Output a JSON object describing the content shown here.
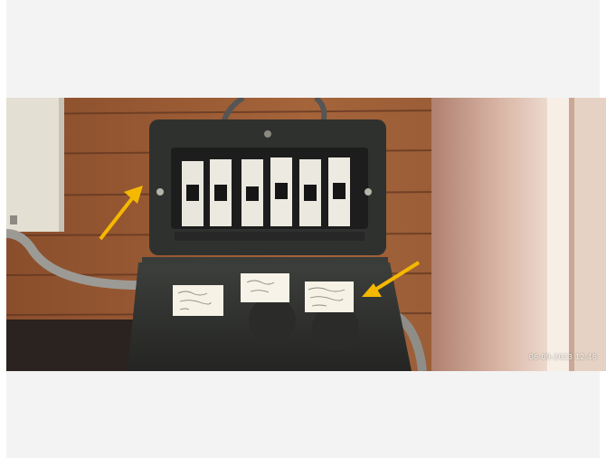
{
  "photo": {
    "timestamp": "06-09-2023 12:46",
    "arrow_color": "#f5b800",
    "breaker_count": 6
  }
}
